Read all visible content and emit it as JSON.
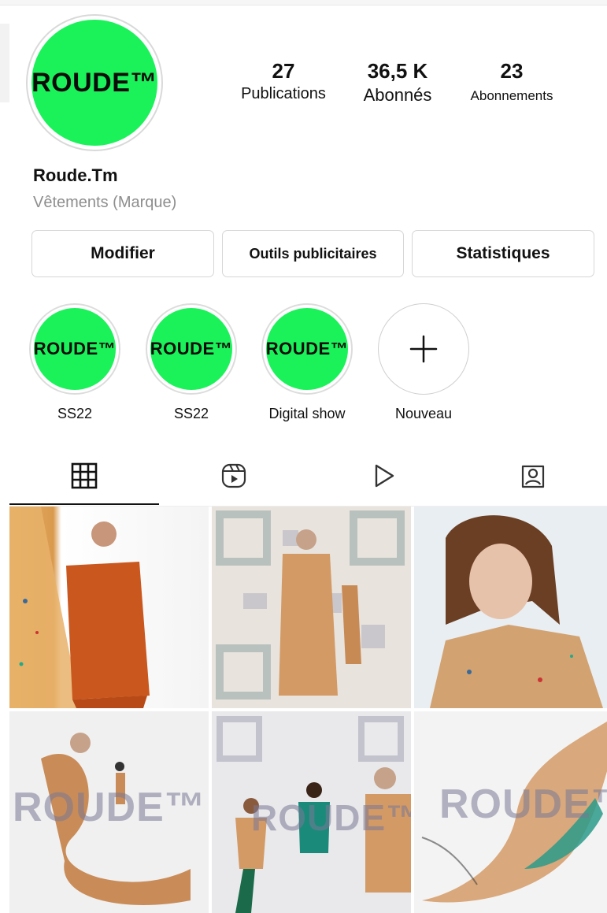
{
  "profile": {
    "avatar_logo": "ROUDE™",
    "name": "Roude.Tm",
    "category": "Vêtements (Marque)"
  },
  "stats": {
    "posts": {
      "value": "27",
      "label": "Publications"
    },
    "followers": {
      "value": "36,5 K",
      "label": "Abonnés"
    },
    "following": {
      "value": "23",
      "label": "Abonnements"
    }
  },
  "buttons": {
    "edit": "Modifier",
    "ad_tools": "Outils publicitaires",
    "insights": "Statistiques"
  },
  "highlights": [
    {
      "label": "SS22",
      "logo": "ROUDE™"
    },
    {
      "label": "SS22",
      "logo": "ROUDE™"
    },
    {
      "label": "Digital show",
      "logo": "ROUDE™"
    },
    {
      "label": "Nouveau",
      "icon": "plus-icon"
    }
  ],
  "tabs": [
    {
      "icon": "grid-icon",
      "active": true
    },
    {
      "icon": "reels-icon",
      "active": false
    },
    {
      "icon": "play-icon",
      "active": false
    },
    {
      "icon": "tagged-icon",
      "active": false
    }
  ],
  "posts_watermark": "ROUDE™",
  "colors": {
    "brand_green": "#1bf25a",
    "text": "#111111",
    "muted": "#8e8e8e",
    "border": "#d6d6d6"
  }
}
